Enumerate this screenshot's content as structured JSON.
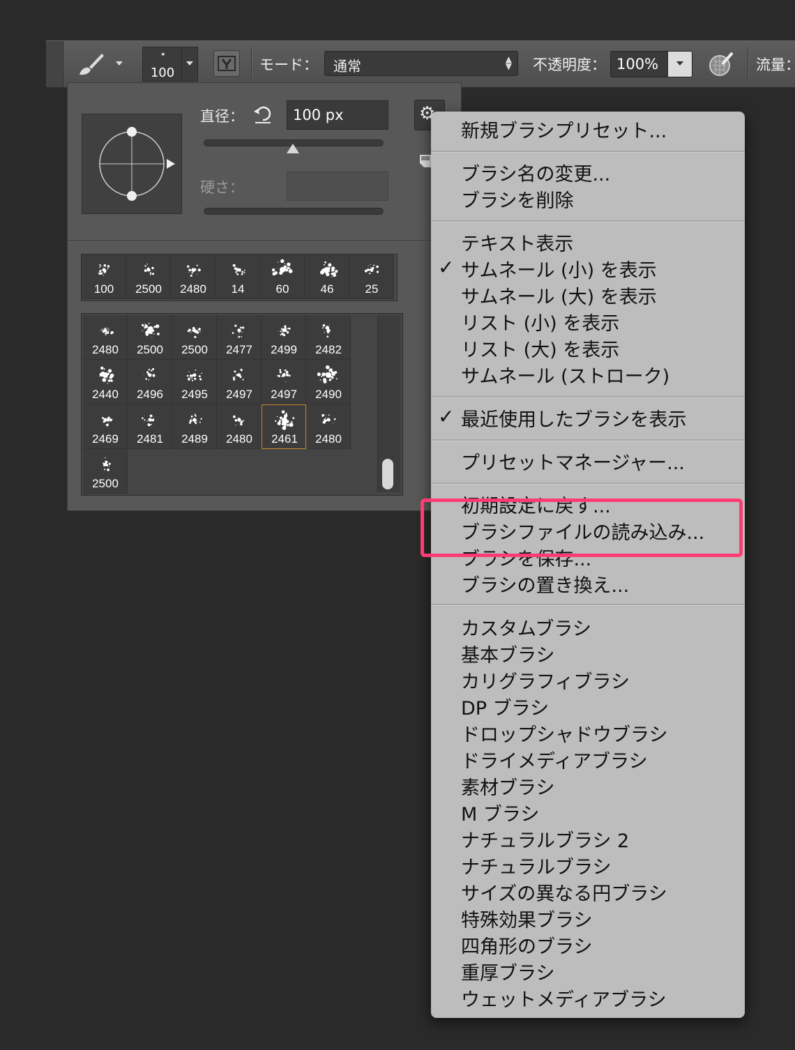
{
  "options_bar": {
    "brush_size": "100",
    "mode_label": "モード：",
    "mode_value": "通常",
    "opacity_label": "不透明度：",
    "opacity_value": "100%",
    "flow_label": "流量："
  },
  "brush_panel": {
    "size_label": "直径：",
    "size_value": "100 px",
    "hardness_label": "硬さ：",
    "recent_brushes": [
      "100",
      "2500",
      "2480",
      "14",
      "60",
      "46",
      "25"
    ],
    "brush_grid": [
      "2480",
      "2500",
      "2500",
      "2477",
      "2499",
      "2482",
      "2440",
      "2496",
      "2495",
      "2497",
      "2497",
      "2490",
      "2469",
      "2481",
      "2489",
      "2480",
      "2461",
      "2480",
      "2500"
    ],
    "selected_index": 16
  },
  "menu": {
    "group1": [
      "新規ブラシプリセット..."
    ],
    "group2": [
      "ブラシ名の変更...",
      "ブラシを削除"
    ],
    "group3": [
      "テキスト表示",
      "サムネール (小) を表示",
      "サムネール (大) を表示",
      "リスト (小) を表示",
      "リスト (大) を表示",
      "サムネール (ストローク)"
    ],
    "group4": [
      "最近使用したブラシを表示"
    ],
    "group5": [
      "プリセットマネージャー..."
    ],
    "group6": [
      "初期設定に戻す...",
      "ブラシファイルの読み込み...",
      "ブラシを保存...",
      "ブラシの置き換え..."
    ],
    "group7": [
      "カスタムブラシ",
      "基本ブラシ",
      "カリグラフィブラシ",
      "DP ブラシ",
      "ドロップシャドウブラシ",
      "ドライメディアブラシ",
      "素材ブラシ",
      "M ブラシ",
      "ナチュラルブラシ 2",
      "ナチュラルブラシ",
      "サイズの異なる円ブラシ",
      "特殊効果ブラシ",
      "四角形のブラシ",
      "重厚ブラシ",
      "ウェットメディアブラシ"
    ],
    "check_mark": "✓",
    "highlight_color": "#fe3c74"
  }
}
